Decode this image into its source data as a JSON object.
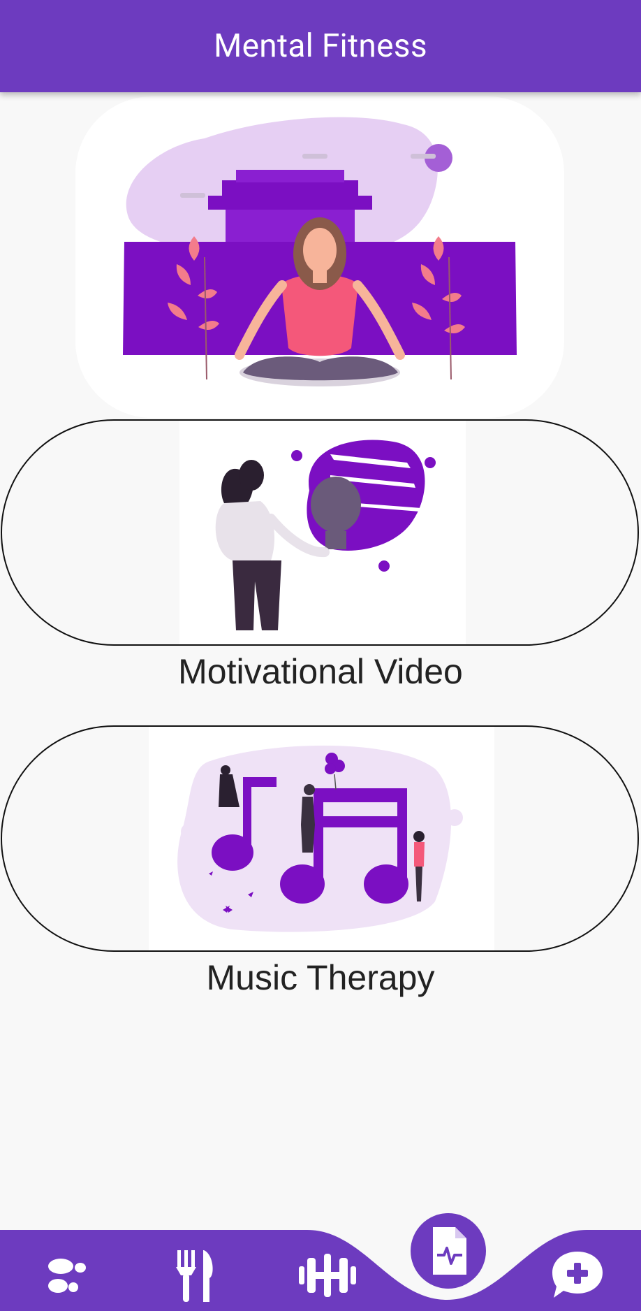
{
  "appbar": {
    "title": "Mental Fitness"
  },
  "cards": [
    {
      "label": "Motivational Video"
    },
    {
      "label": "Music Therapy"
    }
  ],
  "nav": {
    "items": [
      {
        "icon": "footprints-icon"
      },
      {
        "icon": "fork-knife-icon"
      },
      {
        "icon": "dumbbell-icon"
      },
      {
        "icon": "medical-report-icon",
        "active": true
      },
      {
        "icon": "chat-plus-icon"
      }
    ]
  },
  "colors": {
    "primary": "#6d3bbf",
    "purple_dark": "#7b0fc2",
    "lavender": "#e6cff3",
    "background": "#f8f8f8",
    "text": "#222222"
  }
}
